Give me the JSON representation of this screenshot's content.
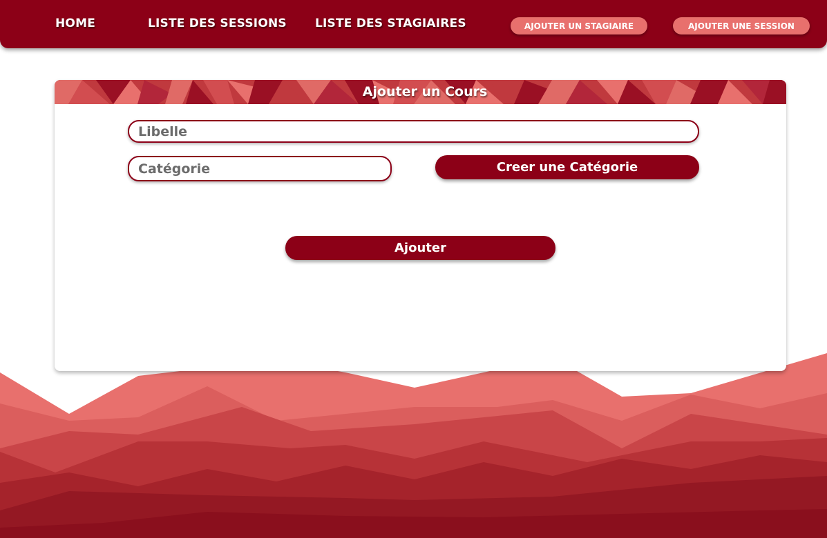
{
  "nav": {
    "links": [
      "HOME",
      "LISTE DES SESSIONS",
      "LISTE DES STAGIAIRES"
    ],
    "actions": [
      "AJOUTER UN STAGIAIRE",
      "AJOUTER UNE SESSION"
    ]
  },
  "form": {
    "title": "Ajouter un Cours",
    "libelle_placeholder": "Libelle",
    "categorie_placeholder": "Catégorie",
    "create_category_label": "Creer une Catégorie",
    "submit_label": "Ajouter"
  },
  "colors": {
    "primary": "#8c0017",
    "accent": "#e8706d",
    "header_facets": [
      "#e06a66",
      "#c0393e",
      "#9a1024",
      "#e8706d",
      "#b2263a"
    ]
  }
}
